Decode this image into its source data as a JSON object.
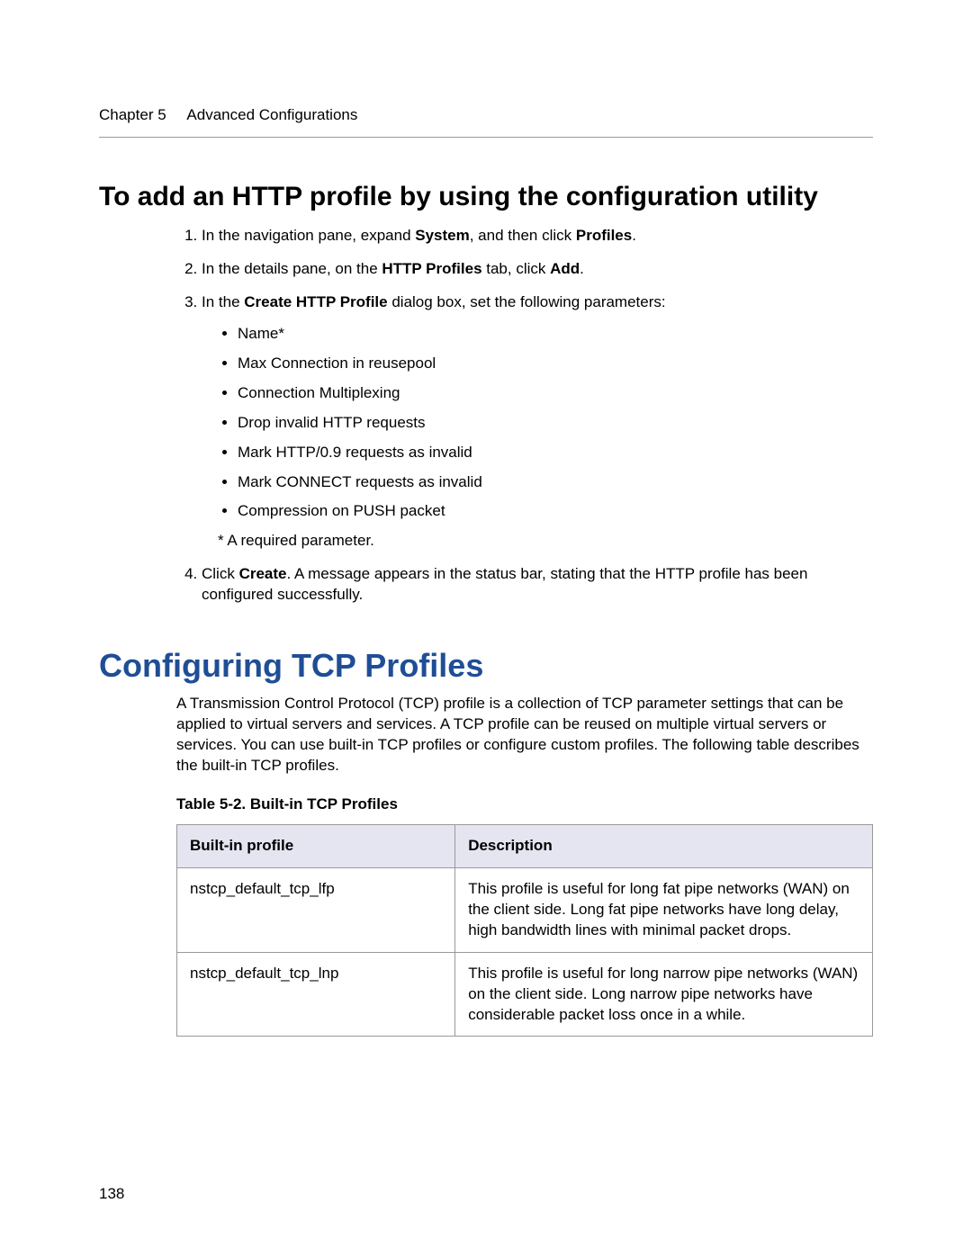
{
  "header": {
    "chapter": "Chapter 5",
    "title": "Advanced Configurations"
  },
  "section_heading": "To add an HTTP profile by using the configuration utility",
  "steps": {
    "s1_pre": "In the navigation pane, expand ",
    "s1_b1": "System",
    "s1_mid": ", and then click ",
    "s1_b2": "Profiles",
    "s1_end": ".",
    "s2_pre": "In the details pane, on the ",
    "s2_b1": "HTTP Profiles",
    "s2_mid": " tab, click ",
    "s2_b2": "Add",
    "s2_end": ".",
    "s3_pre": "In the ",
    "s3_b1": "Create HTTP Profile",
    "s3_end": " dialog box, set the following parameters:",
    "bullets": [
      "Name*",
      "Max Connection in reusepool",
      "Connection Multiplexing",
      "Drop invalid HTTP requests",
      "Mark HTTP/0.9 requests as invalid",
      "Mark CONNECT requests as invalid",
      "Compression on PUSH packet"
    ],
    "required_note": "* A required parameter.",
    "s4_pre": "Click ",
    "s4_b1": "Create",
    "s4_end": ". A message appears in the status bar, stating that the HTTP profile has been configured successfully."
  },
  "major_heading": "Configuring TCP Profiles",
  "intro_para": "A Transmission Control Protocol (TCP) profile is a collection of TCP parameter settings that can be applied to virtual servers and services. A TCP profile can be reused on multiple virtual servers or services. You can use built-in TCP profiles or configure custom profiles. The following table describes the built-in TCP profiles.",
  "table_caption": "Table 5-2. Built-in TCP Profiles",
  "table": {
    "headers": {
      "col1": "Built-in profile",
      "col2": "Description"
    },
    "rows": [
      {
        "profile": "nstcp_default_tcp_lfp",
        "desc": "This profile is useful for long fat pipe networks (WAN) on the client side. Long fat pipe networks have long delay, high bandwidth lines with minimal packet drops."
      },
      {
        "profile": "nstcp_default_tcp_lnp",
        "desc": "This profile is useful for long narrow pipe networks (WAN) on the client side. Long narrow pipe networks have considerable packet loss once in a while."
      }
    ]
  },
  "page_number": "138"
}
